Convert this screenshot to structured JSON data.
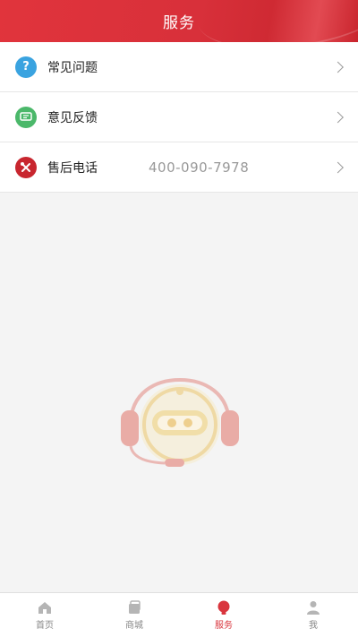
{
  "header": {
    "title": "服务"
  },
  "menu": {
    "items": [
      {
        "label": "常见问题",
        "icon": "question-icon",
        "color": "#3aa3e0"
      },
      {
        "label": "意见反馈",
        "icon": "feedback-icon",
        "color": "#4bb86a"
      },
      {
        "label": "售后电话",
        "icon": "tools-icon",
        "color": "#c8262f",
        "value": "400-090-7978"
      }
    ]
  },
  "illustration": {
    "icon": "robot-support-icon"
  },
  "tabbar": {
    "tabs": [
      {
        "label": "首页",
        "icon": "home-icon"
      },
      {
        "label": "商城",
        "icon": "store-icon"
      },
      {
        "label": "服务",
        "icon": "service-icon",
        "active": true
      },
      {
        "label": "我",
        "icon": "user-icon"
      }
    ]
  },
  "colors": {
    "brand": "#d9353d",
    "background": "#f4f4f4"
  }
}
